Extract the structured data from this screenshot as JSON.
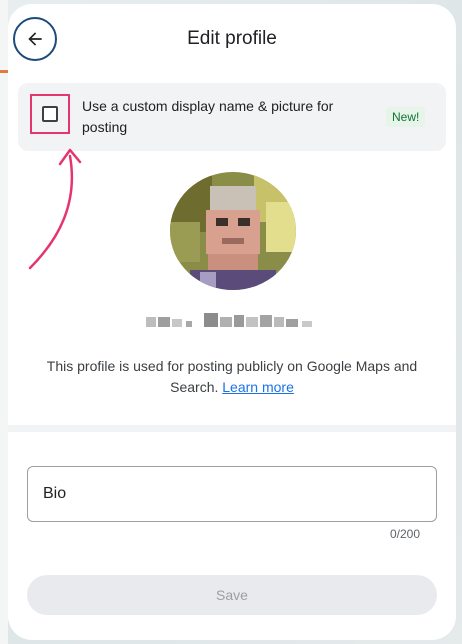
{
  "header": {
    "title": "Edit profile",
    "back_icon": "arrow-left-icon"
  },
  "custom_option": {
    "label": "Use a custom display name & picture for posting",
    "badge": "New!",
    "checked": false
  },
  "profile": {
    "info_text": "This profile is used for posting publicly on Google Maps and Search.",
    "learn_more": "Learn more"
  },
  "bio": {
    "placeholder": "Bio",
    "counter": "0/200"
  },
  "actions": {
    "save_label": "Save"
  },
  "colors": {
    "highlight": "#e5356f",
    "link": "#1a73e8",
    "badge_bg": "#e6f4ea",
    "badge_text": "#137333"
  }
}
